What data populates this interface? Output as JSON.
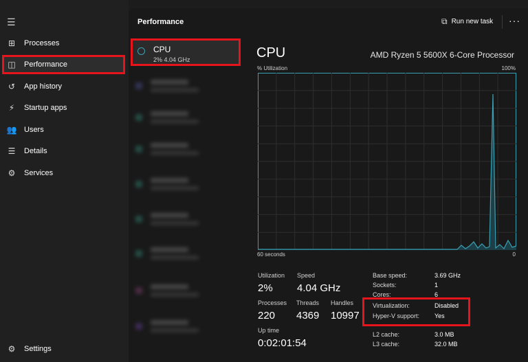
{
  "sidebar": {
    "items": [
      {
        "label": "Processes",
        "icon": "processes-icon",
        "glyph": "⊞"
      },
      {
        "label": "Performance",
        "icon": "performance-icon",
        "glyph": "◫"
      },
      {
        "label": "App history",
        "icon": "app-history-icon",
        "glyph": "↺"
      },
      {
        "label": "Startup apps",
        "icon": "startup-apps-icon",
        "glyph": "⚡"
      },
      {
        "label": "Users",
        "icon": "users-icon",
        "glyph": "👥"
      },
      {
        "label": "Details",
        "icon": "details-icon",
        "glyph": "☰"
      },
      {
        "label": "Services",
        "icon": "services-icon",
        "glyph": "⚙"
      }
    ],
    "settings_label": "Settings"
  },
  "topbar": {
    "title": "Performance",
    "run_task_label": "Run new task"
  },
  "cpu_item": {
    "name": "CPU",
    "sub": "2%  4.04 GHz"
  },
  "detail": {
    "title": "CPU",
    "model": "AMD Ryzen 5 5600X 6-Core Processor",
    "util_label": "% Utilization",
    "util_max": "100%",
    "seconds_label": "60 seconds",
    "zero_label": "0"
  },
  "stats": {
    "utilization_label": "Utilization",
    "utilization_value": "2%",
    "speed_label": "Speed",
    "speed_value": "4.04 GHz",
    "processes_label": "Processes",
    "processes_value": "220",
    "threads_label": "Threads",
    "threads_value": "4369",
    "handles_label": "Handles",
    "handles_value": "10997",
    "uptime_label": "Up time",
    "uptime_value": "0:02:01:54"
  },
  "specs": {
    "base_speed_label": "Base speed:",
    "base_speed_value": "3.69 GHz",
    "sockets_label": "Sockets:",
    "sockets_value": "1",
    "cores_label": "Cores:",
    "cores_value": "6",
    "virtualization_label": "Virtualization:",
    "virtualization_value": "Disabled",
    "hyperv_label": "Hyper-V support:",
    "hyperv_value": "Yes",
    "l2_label": "L2 cache:",
    "l2_value": "3.0 MB",
    "l3_label": "L3 cache:",
    "l3_value": "32.0 MB"
  },
  "colors": {
    "accent_highlight": "#e8141c",
    "cpu_graph_line": "#3aa1b4"
  }
}
